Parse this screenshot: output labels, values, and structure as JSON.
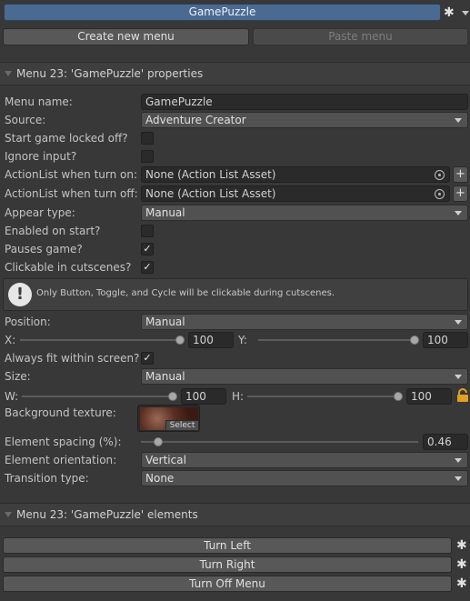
{
  "toolbar": {
    "selected_menu": "GamePuzzle",
    "create_label": "Create new menu",
    "paste_label": "Paste menu"
  },
  "properties": {
    "header": "Menu 23: 'GamePuzzle' properties",
    "menu_name_label": "Menu name:",
    "menu_name_value": "GamePuzzle",
    "source_label": "Source:",
    "source_value": "Adventure Creator",
    "start_locked_label": "Start game locked off?",
    "start_locked_checked": false,
    "ignore_input_label": "Ignore input?",
    "ignore_input_checked": false,
    "al_turn_on_label": "ActionList when turn on:",
    "al_turn_on_value": "None (Action List Asset)",
    "al_turn_off_label": "ActionList when turn off:",
    "al_turn_off_value": "None (Action List Asset)",
    "appear_type_label": "Appear type:",
    "appear_type_value": "Manual",
    "enabled_on_start_label": "Enabled on start?",
    "enabled_on_start_checked": false,
    "pauses_game_label": "Pauses game?",
    "pauses_game_checked": true,
    "clickable_cutscenes_label": "Clickable in cutscenes?",
    "clickable_cutscenes_checked": true,
    "info_text": "Only Button, Toggle, and Cycle will be clickable during cutscenes.",
    "position_label": "Position:",
    "position_value": "Manual",
    "x_label": "X:",
    "x_value": "100",
    "y_label": "Y:",
    "y_value": "100",
    "fit_screen_label": "Always fit within screen?",
    "fit_screen_checked": true,
    "size_label": "Size:",
    "size_value": "Manual",
    "w_label": "W:",
    "w_value": "100",
    "h_label": "H:",
    "h_value": "100",
    "bg_texture_label": "Background texture:",
    "select_label": "Select",
    "spacing_label": "Element spacing (%):",
    "spacing_value": "0.46",
    "orientation_label": "Element orientation:",
    "orientation_value": "Vertical",
    "transition_label": "Transition type:",
    "transition_value": "None"
  },
  "elements": {
    "header": "Menu 23: 'GamePuzzle' elements",
    "items": [
      "Turn Left",
      "Turn Right",
      "Turn Off Menu"
    ]
  },
  "colors": {
    "background": "#383838",
    "selected_bar": "#4a6a92",
    "field": "#2a2a2a",
    "button": "#585858"
  }
}
